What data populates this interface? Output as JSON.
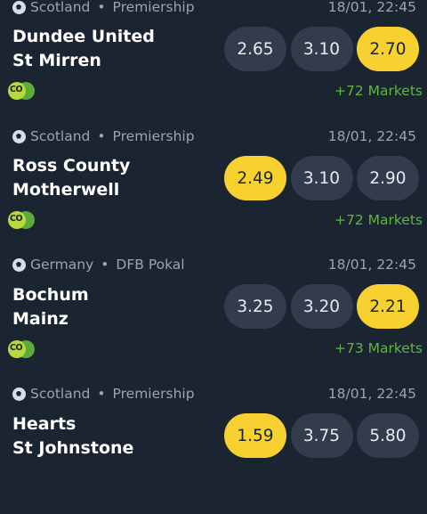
{
  "matches": [
    {
      "country": "Scotland",
      "league": "Premiership",
      "separator": "•",
      "datetime": "18/01, 22:45",
      "home": "Dundee United",
      "away": "St Mirren",
      "odds": [
        "2.65",
        "3.10",
        "2.70"
      ],
      "highlighted_index": 2,
      "badge": "CO",
      "markets": "+72 Markets"
    },
    {
      "country": "Scotland",
      "league": "Premiership",
      "separator": "•",
      "datetime": "18/01, 22:45",
      "home": "Ross County",
      "away": "Motherwell",
      "odds": [
        "2.49",
        "3.10",
        "2.90"
      ],
      "highlighted_index": 0,
      "badge": "CO",
      "markets": "+72 Markets"
    },
    {
      "country": "Germany",
      "league": "DFB Pokal",
      "separator": "•",
      "datetime": "18/01, 22:45",
      "home": "Bochum",
      "away": "Mainz",
      "odds": [
        "3.25",
        "3.20",
        "2.21"
      ],
      "highlighted_index": 2,
      "badge": "CO",
      "markets": "+73 Markets"
    },
    {
      "country": "Scotland",
      "league": "Premiership",
      "separator": "•",
      "datetime": "18/01, 22:45",
      "home": "Hearts",
      "away": "St Johnstone",
      "odds": [
        "1.59",
        "3.75",
        "5.80"
      ],
      "highlighted_index": 0,
      "badge": "",
      "markets": ""
    }
  ],
  "colors": {
    "background": "#1b2431",
    "odd_button": "#323c4c",
    "odd_highlight": "#f6d12f",
    "markets_link": "#5fb544"
  },
  "icons": {
    "sport": "soccer-ball-icon",
    "badge": "cash-out-icon"
  }
}
